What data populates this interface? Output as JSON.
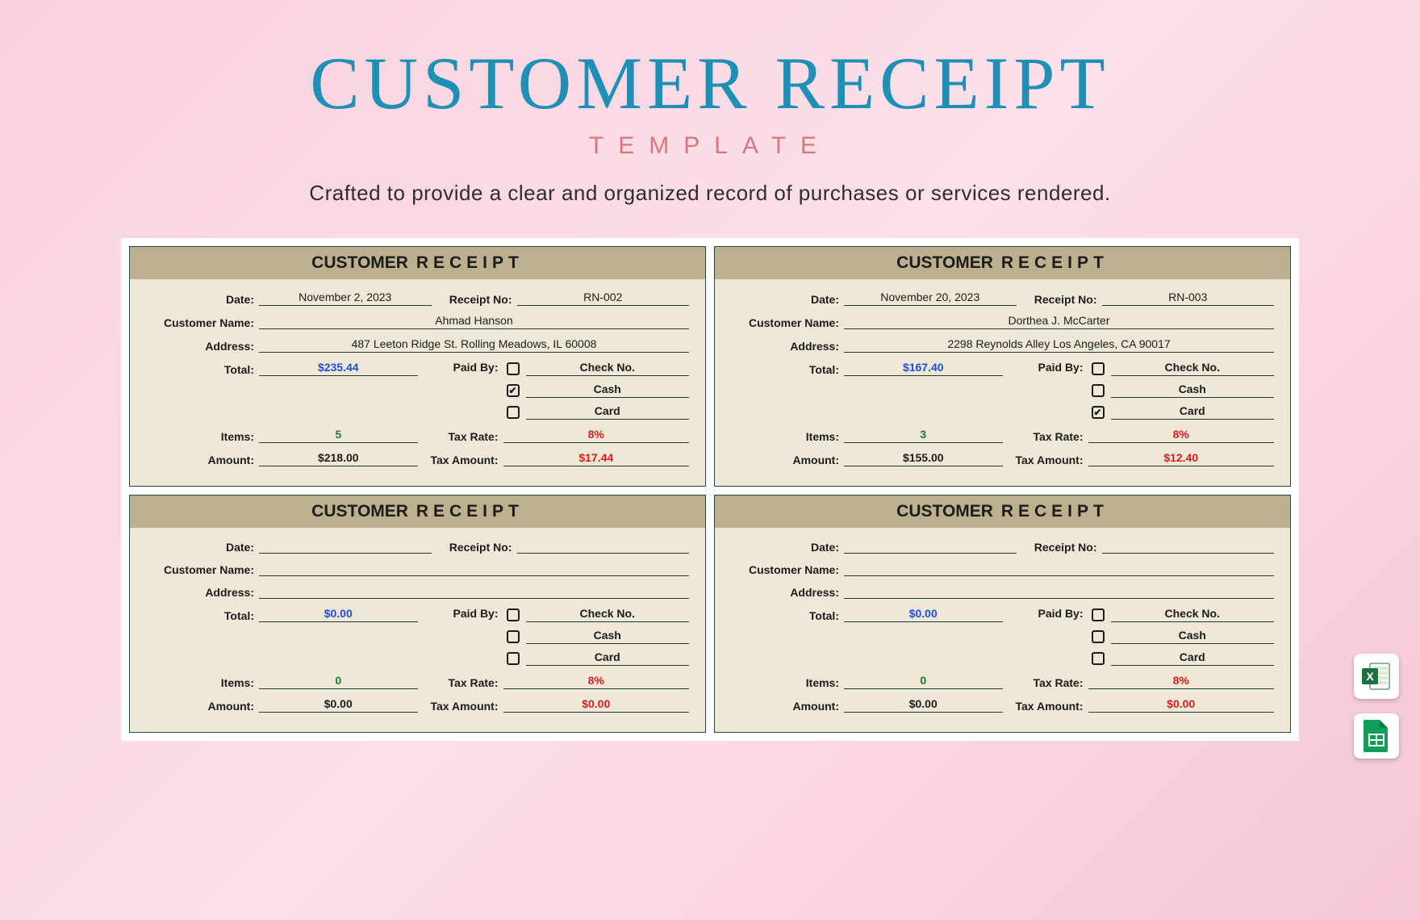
{
  "title": "CUSTOMER RECEIPT",
  "subtitle": "TEMPLATE",
  "desc": "Crafted to provide a clear and organized record of purchases or services rendered.",
  "labels": {
    "header_a": "CUSTOMER",
    "header_b": "RECEIPT",
    "date": "Date:",
    "receipt_no": "Receipt No:",
    "customer": "Customer Name:",
    "address": "Address:",
    "total": "Total:",
    "paid_by": "Paid By:",
    "check": "Check No.",
    "cash": "Cash",
    "card": "Card",
    "items": "Items:",
    "tax_rate": "Tax Rate:",
    "amount": "Amount:",
    "tax_amount": "Tax Amount:"
  },
  "receipts": [
    {
      "date": "November 2, 2023",
      "receipt_no": "RN-002",
      "customer": "Ahmad Hanson",
      "address": "487 Leeton Ridge St. Rolling Meadows, IL 60008",
      "total": "$235.44",
      "paid": {
        "check": false,
        "cash": true,
        "card": false
      },
      "items": "5",
      "tax_rate": "8%",
      "amount": "$218.00",
      "tax_amount": "$17.44"
    },
    {
      "date": "November 20, 2023",
      "receipt_no": "RN-003",
      "customer": "Dorthea J. McCarter",
      "address": "2298 Reynolds Alley Los Angeles, CA 90017",
      "total": "$167.40",
      "paid": {
        "check": false,
        "cash": false,
        "card": true
      },
      "items": "3",
      "tax_rate": "8%",
      "amount": "$155.00",
      "tax_amount": "$12.40"
    },
    {
      "date": "",
      "receipt_no": "",
      "customer": "",
      "address": "",
      "total": "$0.00",
      "paid": {
        "check": false,
        "cash": false,
        "card": false
      },
      "items": "0",
      "tax_rate": "8%",
      "amount": "$0.00",
      "tax_amount": "$0.00"
    },
    {
      "date": "",
      "receipt_no": "",
      "customer": "",
      "address": "",
      "total": "$0.00",
      "paid": {
        "check": false,
        "cash": false,
        "card": false
      },
      "items": "0",
      "tax_rate": "8%",
      "amount": "$0.00",
      "tax_amount": "$0.00"
    }
  ],
  "icons": {
    "excel": "excel-icon",
    "sheets": "sheets-icon"
  }
}
